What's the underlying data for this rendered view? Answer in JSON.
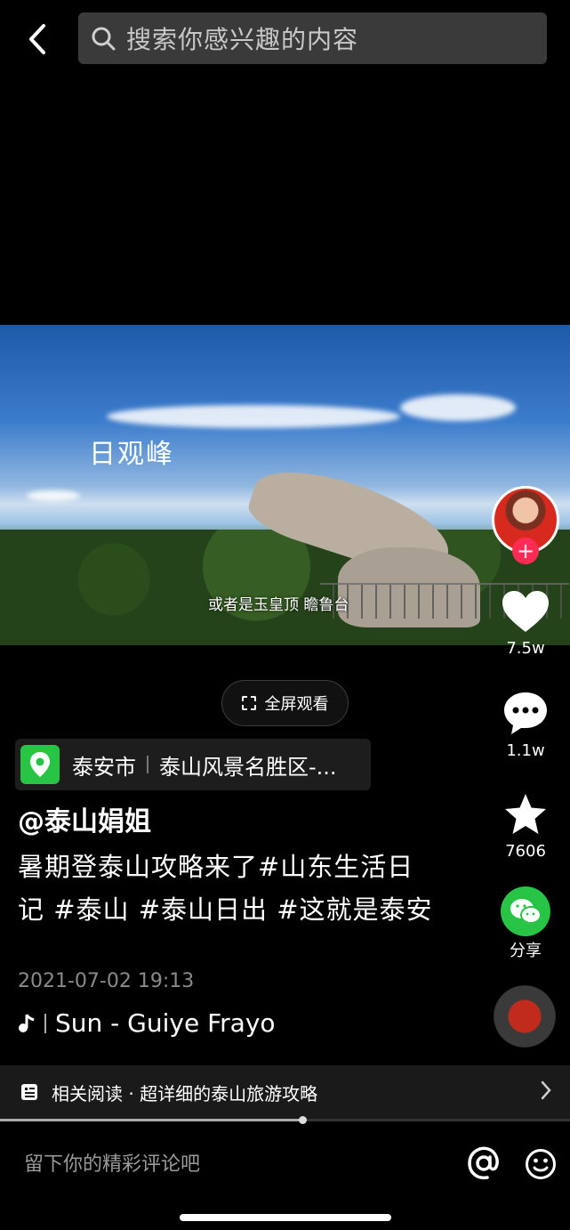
{
  "search": {
    "placeholder": "搜索你感兴趣的内容"
  },
  "video": {
    "overlay_title": "日观峰",
    "subtitle": "或者是玉皇顶 瞻鲁台"
  },
  "actions": {
    "likes": "7.5w",
    "comments": "1.1w",
    "favorites": "7606",
    "share_label": "分享",
    "follow_symbol": "+"
  },
  "fullscreen_label": "全屏观看",
  "location": {
    "city": "泰安市",
    "scenic": "泰山风景名胜区-..."
  },
  "post": {
    "author": "@泰山娟姐",
    "caption": "暑期登泰山攻略来了#山东生活日记 #泰山 #泰山日出 #这就是泰安",
    "timestamp": "2021-07-02 19:13",
    "music": "Sun - Guiye Frayo"
  },
  "related": {
    "label": "相关阅读 · 超详细的泰山旅游攻略"
  },
  "progress": {
    "fraction": 0.53
  },
  "comment": {
    "placeholder": "留下你的精彩评论吧"
  },
  "colors": {
    "accent": "#fe2c55",
    "wechat": "#28c445",
    "background": "#000000"
  }
}
